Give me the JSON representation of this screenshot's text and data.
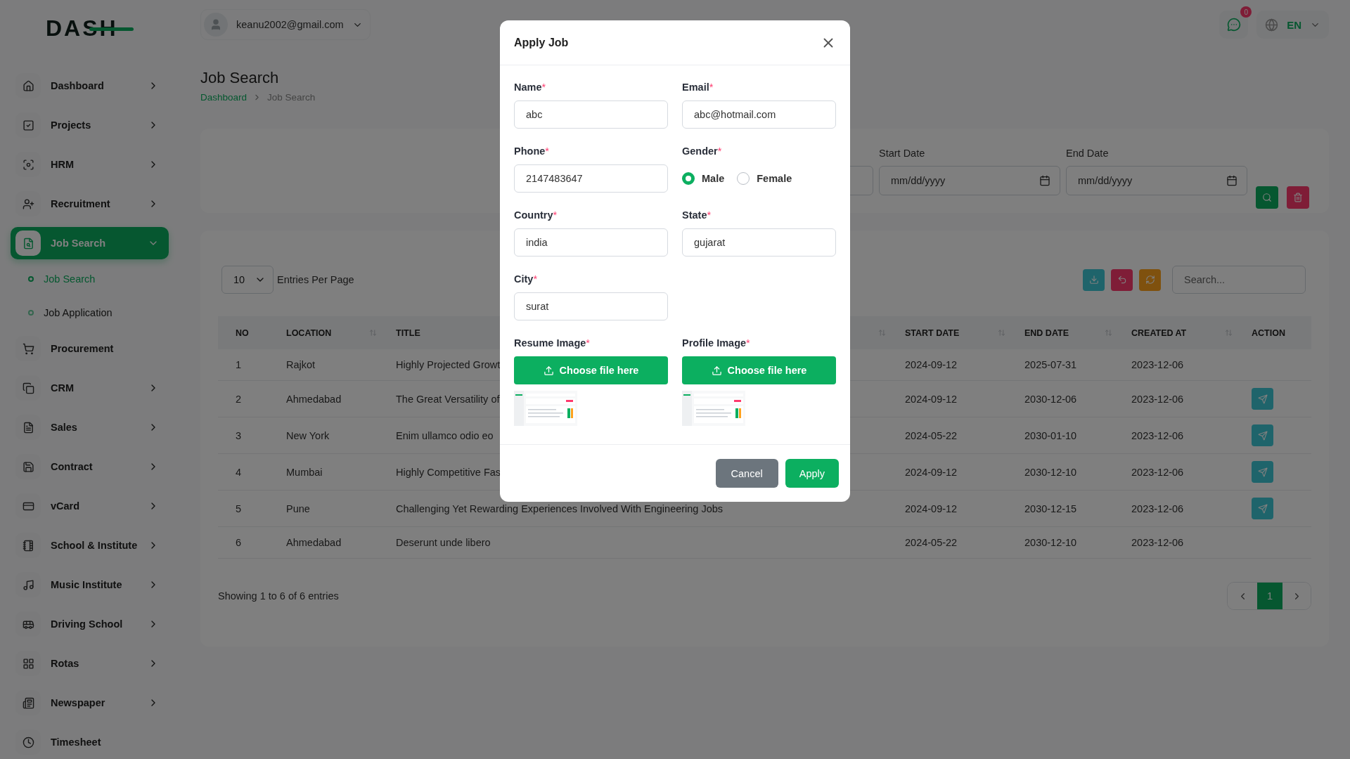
{
  "logo": "DASH",
  "user": {
    "email": "keanu2002@gmail.com"
  },
  "notifications": {
    "count": "0"
  },
  "language": {
    "code": "EN"
  },
  "sidebar": {
    "items": [
      {
        "label": "Dashboard",
        "submenu": true,
        "expanded": false,
        "selected": false
      },
      {
        "label": "Projects",
        "submenu": true,
        "expanded": false,
        "selected": false
      },
      {
        "label": "HRM",
        "submenu": true,
        "expanded": false,
        "selected": false
      },
      {
        "label": "Recruitment",
        "submenu": true,
        "expanded": false,
        "selected": false
      },
      {
        "label": "Job Search",
        "submenu": true,
        "expanded": true,
        "selected": true,
        "children": [
          {
            "label": "Job Search",
            "selected": true
          },
          {
            "label": "Job Application",
            "selected": false
          }
        ]
      },
      {
        "label": "Procurement",
        "submenu": false,
        "selected": false
      },
      {
        "label": "CRM",
        "submenu": true,
        "expanded": false,
        "selected": false
      },
      {
        "label": "Sales",
        "submenu": true,
        "expanded": false,
        "selected": false
      },
      {
        "label": "Contract",
        "submenu": true,
        "expanded": false,
        "selected": false
      },
      {
        "label": "vCard",
        "submenu": true,
        "expanded": false,
        "selected": false
      },
      {
        "label": "School & Institute",
        "submenu": true,
        "expanded": false,
        "selected": false
      },
      {
        "label": "Music Institute",
        "submenu": true,
        "expanded": false,
        "selected": false
      },
      {
        "label": "Driving School",
        "submenu": true,
        "expanded": false,
        "selected": false
      },
      {
        "label": "Rotas",
        "submenu": true,
        "expanded": false,
        "selected": false
      },
      {
        "label": "Newspaper",
        "submenu": true,
        "expanded": false,
        "selected": false
      },
      {
        "label": "Timesheet",
        "submenu": false,
        "selected": false
      }
    ]
  },
  "page": {
    "title": "Job Search",
    "breadcrumb": [
      {
        "label": "Dashboard",
        "link": true
      },
      {
        "label": "Job Search",
        "link": false
      }
    ]
  },
  "filters": {
    "fields": [
      {
        "kind": "blank"
      },
      {
        "kind": "date",
        "label": "Start Date",
        "placeholder": "mm/dd/yyyy"
      },
      {
        "kind": "date",
        "label": "End Date",
        "placeholder": "mm/dd/yyyy"
      }
    ],
    "buttons": [
      {
        "kind": "search"
      },
      {
        "kind": "clear"
      }
    ]
  },
  "table": {
    "entries": {
      "value": "10",
      "label": "Entries Per Page"
    },
    "tools": [
      {
        "kind": "download"
      },
      {
        "kind": "undo"
      },
      {
        "kind": "refresh"
      }
    ],
    "search": {
      "placeholder": "Search..."
    },
    "columns": [
      {
        "label": "NO",
        "sortable": false
      },
      {
        "label": "LOCATION",
        "sortable": true
      },
      {
        "label": "TITLE",
        "sortable": true
      },
      {
        "label": "START DATE",
        "sortable": true
      },
      {
        "label": "END DATE",
        "sortable": true
      },
      {
        "label": "CREATED AT",
        "sortable": true
      },
      {
        "label": "ACTION",
        "sortable": false
      }
    ],
    "rows": [
      {
        "no": "1",
        "location": "Rajkot",
        "title": "Highly Projected Growt",
        "start_date": "2024-09-12",
        "end_date": "2025-07-31",
        "created_at": "2023-12-06",
        "apply_button": false
      },
      {
        "no": "2",
        "location": "Ahmedabad",
        "title": "The Great Versatility of",
        "start_date": "2024-09-12",
        "end_date": "2030-12-06",
        "created_at": "2023-12-06",
        "apply_button": true
      },
      {
        "no": "3",
        "location": "New York",
        "title": "Enim ullamco odio eo",
        "start_date": "2024-05-22",
        "end_date": "2030-01-10",
        "created_at": "2023-12-06",
        "apply_button": true
      },
      {
        "no": "4",
        "location": "Mumbai",
        "title": "Highly Competitive Fas",
        "start_date": "2024-09-12",
        "end_date": "2030-12-10",
        "created_at": "2023-12-06",
        "apply_button": true
      },
      {
        "no": "5",
        "location": "Pune",
        "title": "Challenging Yet Rewarding Experiences Involved With Engineering Jobs",
        "start_date": "2024-09-12",
        "end_date": "2030-12-15",
        "created_at": "2023-12-06",
        "apply_button": true
      },
      {
        "no": "6",
        "location": "Ahmedabad",
        "title": "Deserunt unde libero",
        "start_date": "2024-05-22",
        "end_date": "2030-12-10",
        "created_at": "2023-12-06",
        "apply_button": false
      }
    ],
    "summary": "Showing 1 to 6 of 6 entries",
    "pagination": {
      "pages": [
        {
          "label": "1",
          "selected": true
        }
      ]
    }
  },
  "modal": {
    "title": "Apply Job",
    "fields": [
      {
        "kind": "text",
        "label": "Name",
        "mark": "*",
        "value": "abc"
      },
      {
        "kind": "text",
        "label": "Email",
        "mark": "*",
        "value": "abc@hotmail.com"
      },
      {
        "kind": "text",
        "label": "Phone",
        "mark": "*",
        "value": "2147483647"
      },
      {
        "kind": "radio",
        "label": "Gender",
        "mark": "*",
        "options": [
          {
            "label": "Male",
            "selected": true
          },
          {
            "label": "Female",
            "selected": false
          }
        ]
      },
      {
        "kind": "text",
        "label": "Country",
        "mark": "*",
        "value": "india"
      },
      {
        "kind": "text",
        "label": "State",
        "mark": "*",
        "value": "gujarat"
      },
      {
        "kind": "text",
        "label": "City",
        "mark": "*",
        "value": "surat"
      }
    ],
    "uploads": [
      {
        "label": "Resume Image",
        "mark": "*",
        "button": "Choose file here"
      },
      {
        "label": "Profile Image",
        "mark": "*",
        "button": "Choose file here"
      }
    ],
    "buttons": [
      {
        "kind": "secondary",
        "label": "Cancel"
      },
      {
        "kind": "primary",
        "label": "Apply"
      }
    ]
  }
}
